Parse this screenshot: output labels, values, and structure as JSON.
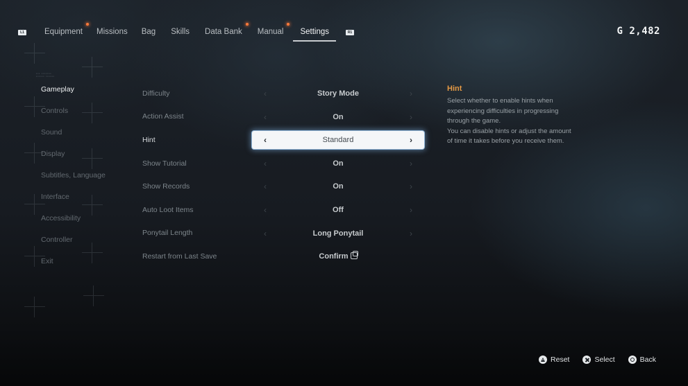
{
  "top_nav": {
    "left_shoulder": "L1",
    "right_shoulder": "R1",
    "tabs": [
      {
        "label": "Equipment",
        "notification": true,
        "active": false
      },
      {
        "label": "Missions",
        "notification": false,
        "active": false
      },
      {
        "label": "Bag",
        "notification": false,
        "active": false
      },
      {
        "label": "Skills",
        "notification": false,
        "active": false
      },
      {
        "label": "Data Bank",
        "notification": true,
        "active": false
      },
      {
        "label": "Manual",
        "notification": true,
        "active": false
      },
      {
        "label": "Settings",
        "notification": false,
        "active": true
      }
    ]
  },
  "currency": {
    "symbol": "G",
    "amount": "2,482"
  },
  "sidebar": {
    "items": [
      {
        "label": "Gameplay",
        "active": true
      },
      {
        "label": "Controls"
      },
      {
        "label": "Sound"
      },
      {
        "label": "Display"
      },
      {
        "label": "Subtitles, Language"
      },
      {
        "label": "Interface"
      },
      {
        "label": "Accessibility"
      },
      {
        "label": "Controller"
      },
      {
        "label": "Exit"
      }
    ]
  },
  "settings": {
    "rows": [
      {
        "label": "Difficulty",
        "value": "Story Mode"
      },
      {
        "label": "Action Assist",
        "value": "On"
      },
      {
        "label": "Hint",
        "value": "Standard",
        "focused": true
      },
      {
        "label": "Show Tutorial",
        "value": "On"
      },
      {
        "label": "Show Records",
        "value": "On"
      },
      {
        "label": "Auto Loot Items",
        "value": "Off"
      },
      {
        "label": "Ponytail Length",
        "value": "Long Ponytail"
      },
      {
        "label": "Restart from Last Save",
        "action": "Confirm"
      }
    ],
    "arrow_left": "‹",
    "arrow_right": "›"
  },
  "description": {
    "title": "Hint",
    "lines": [
      "Select whether to enable hints when",
      "experiencing difficulties in progressing",
      "through the game.",
      "You can disable hints or adjust the amount",
      "of time it takes before you receive them."
    ]
  },
  "footer": {
    "buttons": [
      {
        "icon": "triangle-button-icon",
        "label": "Reset"
      },
      {
        "icon": "cross-button-icon",
        "label": "Select"
      },
      {
        "icon": "circle-button-icon",
        "label": "Back"
      }
    ]
  },
  "colors": {
    "accent_orange": "#e69a45",
    "notification_dot": "#ff7a3a",
    "focus_glow": "#8fb4d6"
  }
}
